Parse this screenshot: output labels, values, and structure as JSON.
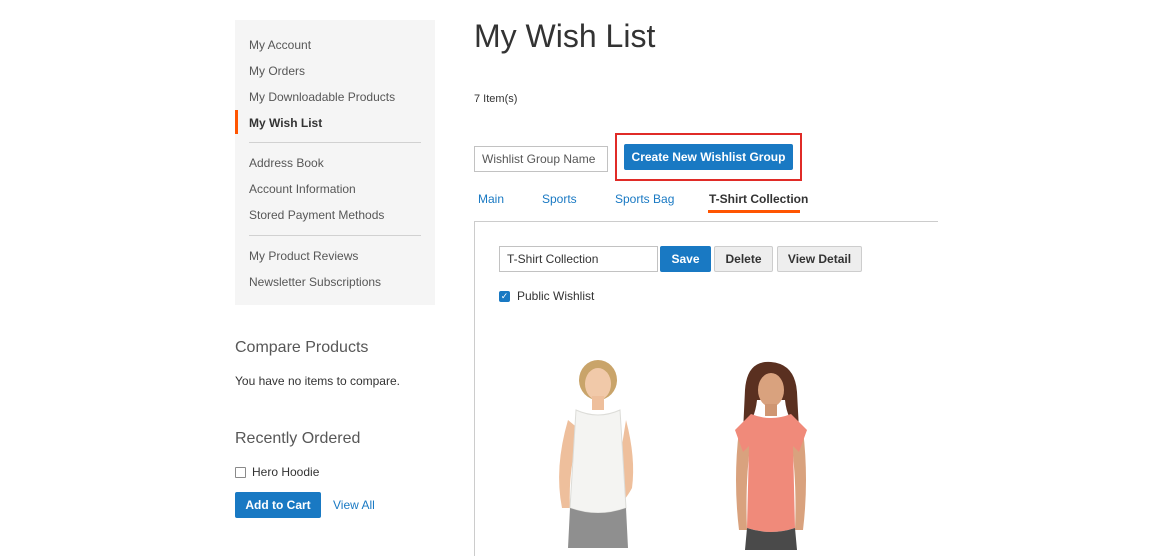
{
  "sidebar": {
    "nav_items": [
      {
        "label": "My Account"
      },
      {
        "label": "My Orders"
      },
      {
        "label": "My Downloadable Products"
      },
      {
        "label": "My Wish List",
        "active": true
      },
      {
        "label": "Address Book"
      },
      {
        "label": "Account Information"
      },
      {
        "label": "Stored Payment Methods"
      },
      {
        "label": "My Product Reviews"
      },
      {
        "label": "Newsletter Subscriptions"
      }
    ],
    "compare": {
      "title": "Compare Products",
      "empty_text": "You have no items to compare."
    },
    "recently_ordered": {
      "title": "Recently Ordered",
      "item_label": "Hero Hoodie",
      "item_checked": false,
      "add_to_cart_label": "Add to Cart",
      "view_all_label": "View All"
    }
  },
  "main": {
    "title": "My Wish List",
    "item_count": "7 Item(s)",
    "group_name_placeholder": "Wishlist Group Name",
    "create_group_label": "Create New Wishlist Group",
    "tabs": [
      {
        "label": "Main"
      },
      {
        "label": "Sports"
      },
      {
        "label": "Sports Bag"
      },
      {
        "label": "T-Shirt Collection",
        "active": true
      }
    ],
    "group": {
      "name_value": "T-Shirt Collection",
      "save_label": "Save",
      "delete_label": "Delete",
      "view_detail_label": "View Detail",
      "public_label": "Public Wishlist",
      "public_checked": true
    }
  },
  "colors": {
    "primary_blue": "#1979c3",
    "active_accent": "#ff5501",
    "highlight_red": "#e02b27",
    "sidebar_bg": "#f5f5f5"
  },
  "icons": {
    "checkbox_checked": "check-icon"
  }
}
